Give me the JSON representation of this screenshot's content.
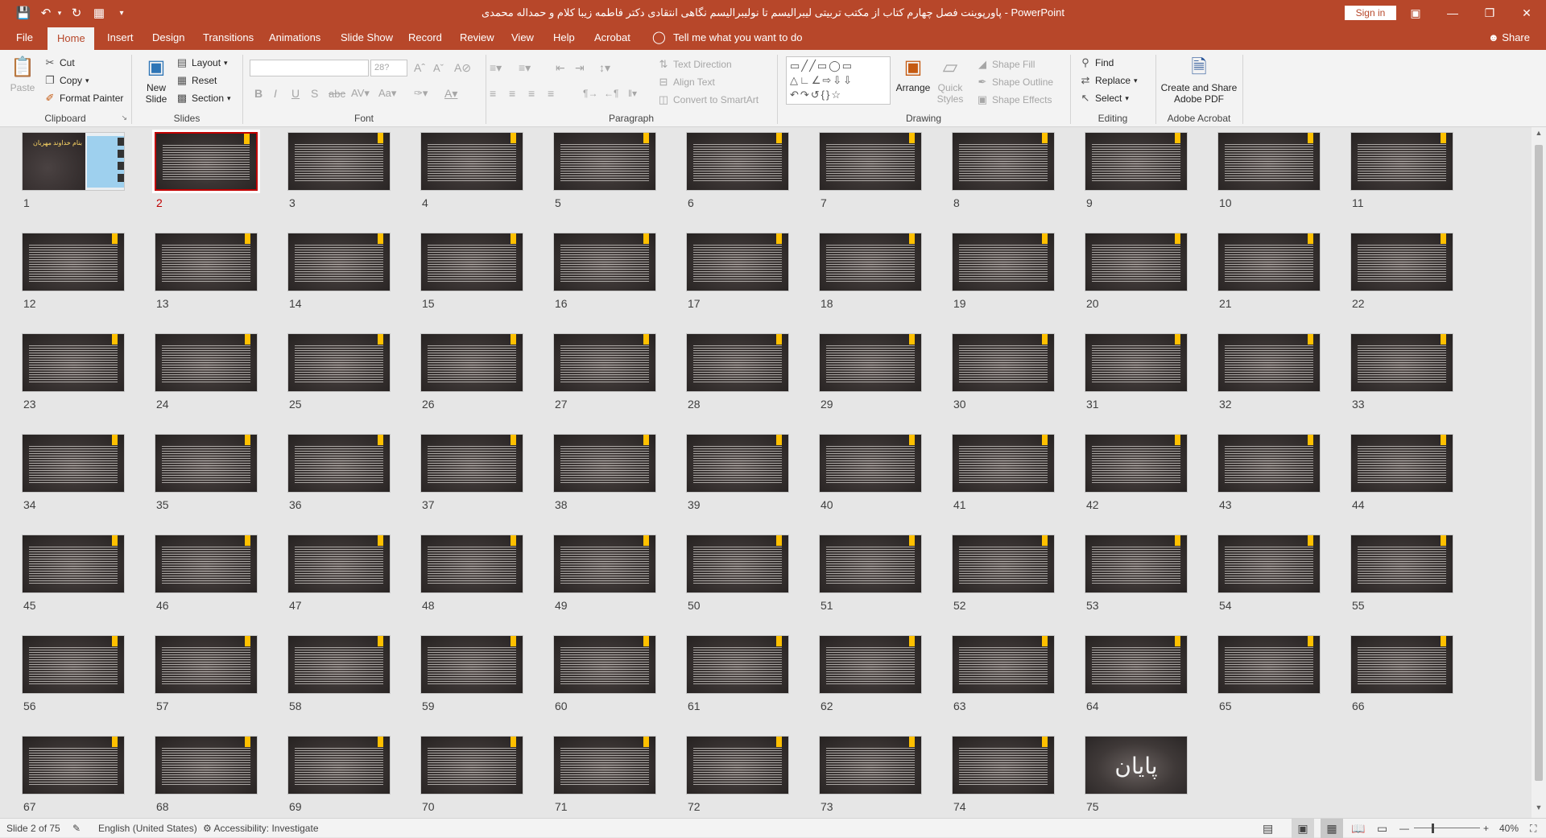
{
  "titlebar": {
    "title": "پاورپوینت فصل چهارم کتاب از مکتب تربیتی لیبرالیسم تا نولیبرالیسم نگاهی انتقادی دکتر فاطمه زیبا کلام و حمداله محمدی  -  PowerPoint",
    "sign_in": "Sign in"
  },
  "tabs": [
    "File",
    "Home",
    "Insert",
    "Design",
    "Transitions",
    "Animations",
    "Slide Show",
    "Record",
    "Review",
    "View",
    "Help",
    "Acrobat"
  ],
  "tell_me": "Tell me what you want to do",
  "share": "Share",
  "ribbon": {
    "clipboard": {
      "paste": "Paste",
      "cut": "Cut",
      "copy": "Copy",
      "format_painter": "Format Painter",
      "label": "Clipboard"
    },
    "slides": {
      "new_slide_line1": "New",
      "new_slide_line2": "Slide",
      "layout": "Layout",
      "reset": "Reset",
      "section": "Section",
      "label": "Slides"
    },
    "font": {
      "font_size": "28?",
      "label": "Font"
    },
    "paragraph": {
      "text_direction": "Text Direction",
      "align_text": "Align Text",
      "convert_smartart": "Convert to SmartArt",
      "label": "Paragraph"
    },
    "drawing": {
      "arrange": "Arrange",
      "quick_styles_line1": "Quick",
      "quick_styles_line2": "Styles",
      "shape_fill": "Shape Fill",
      "shape_outline": "Shape Outline",
      "shape_effects": "Shape Effects",
      "label": "Drawing"
    },
    "editing": {
      "find": "Find",
      "replace": "Replace",
      "select": "Select",
      "label": "Editing"
    },
    "acrobat": {
      "create_line1": "Create and Share",
      "create_line2": "Adobe PDF",
      "label": "Adobe Acrobat"
    }
  },
  "slides": {
    "count": 75,
    "selected": 2,
    "numbers": [
      "1",
      "2",
      "3",
      "4",
      "5",
      "6",
      "7",
      "8",
      "9",
      "10",
      "11",
      "12",
      "13",
      "14",
      "15",
      "16",
      "17",
      "18",
      "19",
      "20",
      "21",
      "22",
      "23",
      "24",
      "25",
      "26",
      "27",
      "28",
      "29",
      "30",
      "31",
      "32",
      "33",
      "34",
      "35",
      "36",
      "37",
      "38",
      "39",
      "40",
      "41",
      "42",
      "43",
      "44",
      "45",
      "46",
      "47",
      "48",
      "49",
      "50",
      "51",
      "52",
      "53",
      "54",
      "55",
      "56",
      "57",
      "58",
      "59",
      "60",
      "61",
      "62",
      "63",
      "64",
      "65",
      "66",
      "67",
      "68",
      "69",
      "70",
      "71",
      "72",
      "73",
      "74",
      "75"
    ],
    "cover_text": "بنام خداوند مهربان",
    "end_text": "پایان"
  },
  "statusbar": {
    "slide_of": "Slide 2 of 75",
    "language": "English (United States)",
    "accessibility": "Accessibility: Investigate",
    "zoom": "40%"
  },
  "colors": {
    "accent": "#b7472a",
    "selection": "#c00000",
    "tag": "#ffc000"
  }
}
